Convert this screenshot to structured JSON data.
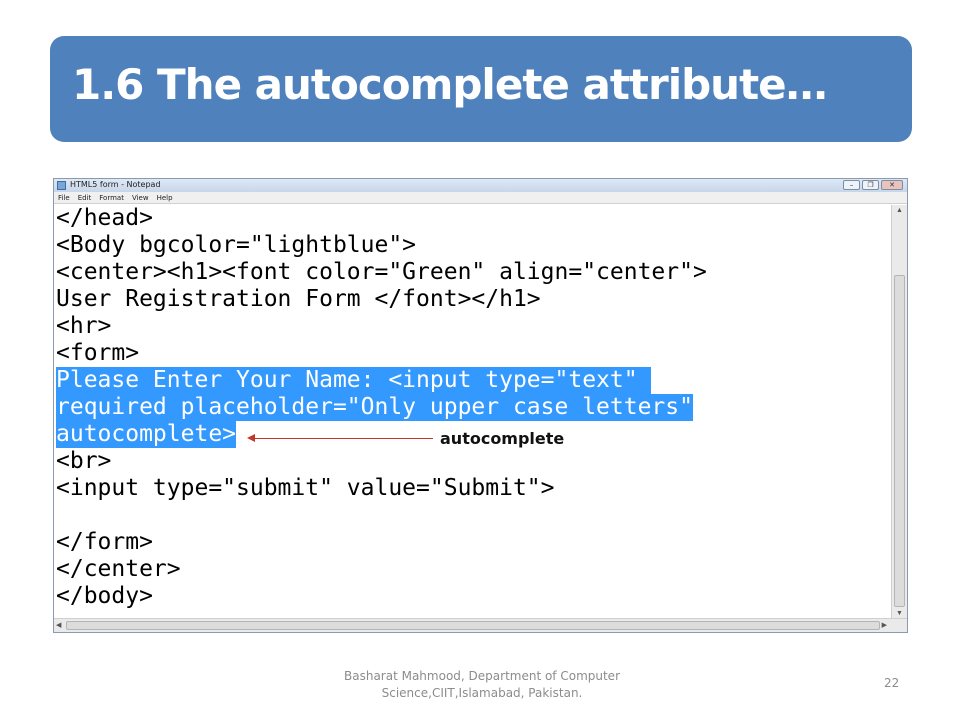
{
  "slide": {
    "title": "1.6 The autocomplete attribute…",
    "footer": "Basharat Mahmood, Department of Computer Science,CIIT,Islamabad, Pakistan.",
    "page_number": "22"
  },
  "window": {
    "title": "HTML5 form - Notepad",
    "minimize_glyph": "–",
    "maximize_glyph": "❐",
    "close_glyph": "✕",
    "menu": [
      "File",
      "Edit",
      "Format",
      "View",
      "Help"
    ]
  },
  "code": {
    "lines": [
      "</head>",
      "<Body bgcolor=\"lightblue\">",
      "<center><h1><font color=\"Green\" align=\"center\">",
      "User Registration Form </font></h1>",
      "<hr>",
      "<form>",
      "Please Enter Your Name: <input type=\"text\" ",
      "required placeholder=\"Only upper case letters\"",
      "autocomplete>",
      "<br>",
      "<input type=\"submit\" value=\"Submit\">",
      "",
      "</form>",
      "</center>",
      "</body>"
    ],
    "selected_lines": [
      6,
      7,
      8
    ]
  },
  "annotation": {
    "label": "autocomplete",
    "color": "#c0392b"
  },
  "colors": {
    "title_bar": "#4f81bd",
    "selection": "#3399ff"
  },
  "icons": {
    "scroll_up": "▲",
    "scroll_down": "▼",
    "scroll_left": "◀",
    "scroll_right": "▶"
  }
}
